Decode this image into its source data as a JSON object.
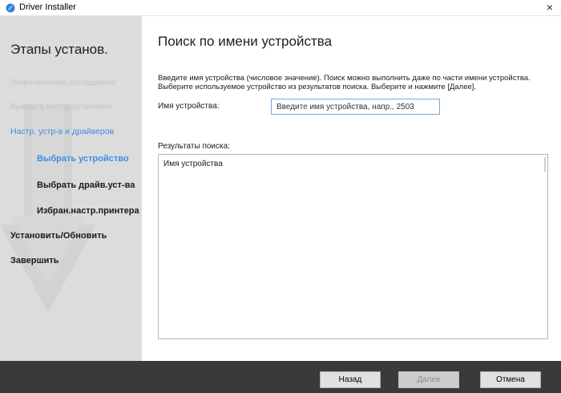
{
  "window": {
    "title": "Driver Installer",
    "close_glyph": "×"
  },
  "sidebar": {
    "title": "Этапы установ.",
    "steps": [
      {
        "label": "Лицензионное соглашение",
        "state": "done"
      },
      {
        "label": "Выбрать метод установки",
        "state": "done"
      },
      {
        "label": "Настр. устр-в и драйверов",
        "state": "active"
      },
      {
        "label": "Выбрать устройство",
        "state": "current"
      },
      {
        "label": "Выбрать драйв.уст-ва",
        "state": "pending"
      },
      {
        "label": "Избран.настр.принтера",
        "state": "pending"
      },
      {
        "label": "Установить/Обновить",
        "state": "pending"
      },
      {
        "label": "Завершить",
        "state": "pending"
      }
    ]
  },
  "main": {
    "title": "Поиск по имени устройства",
    "description_line1": "Введите имя устройства (числовое значение). Поиск можно выполнить даже по части имени устройства.",
    "description_line2": "Выберите используемое устройство из результатов поиска. Выберите и нажмите [Далее].",
    "device_name_label": "Имя устройства:",
    "device_name_value": "",
    "device_name_placeholder": "Введите имя устройства, напр., 2503",
    "results_label": "Результаты поиска:",
    "results_column_header": "Имя устройства",
    "results_rows": []
  },
  "footer": {
    "back_label": "Назад",
    "next_label": "Далее",
    "cancel_label": "Отмена",
    "next_enabled": false
  },
  "colors": {
    "accent": "#3d8fe6",
    "sidebar_bg": "#dcdcdc",
    "footer_bg": "#3a3a3a",
    "done_step": "#c3c3c3"
  },
  "icons": {
    "app": "driver-installer-icon",
    "close": "close-icon"
  }
}
